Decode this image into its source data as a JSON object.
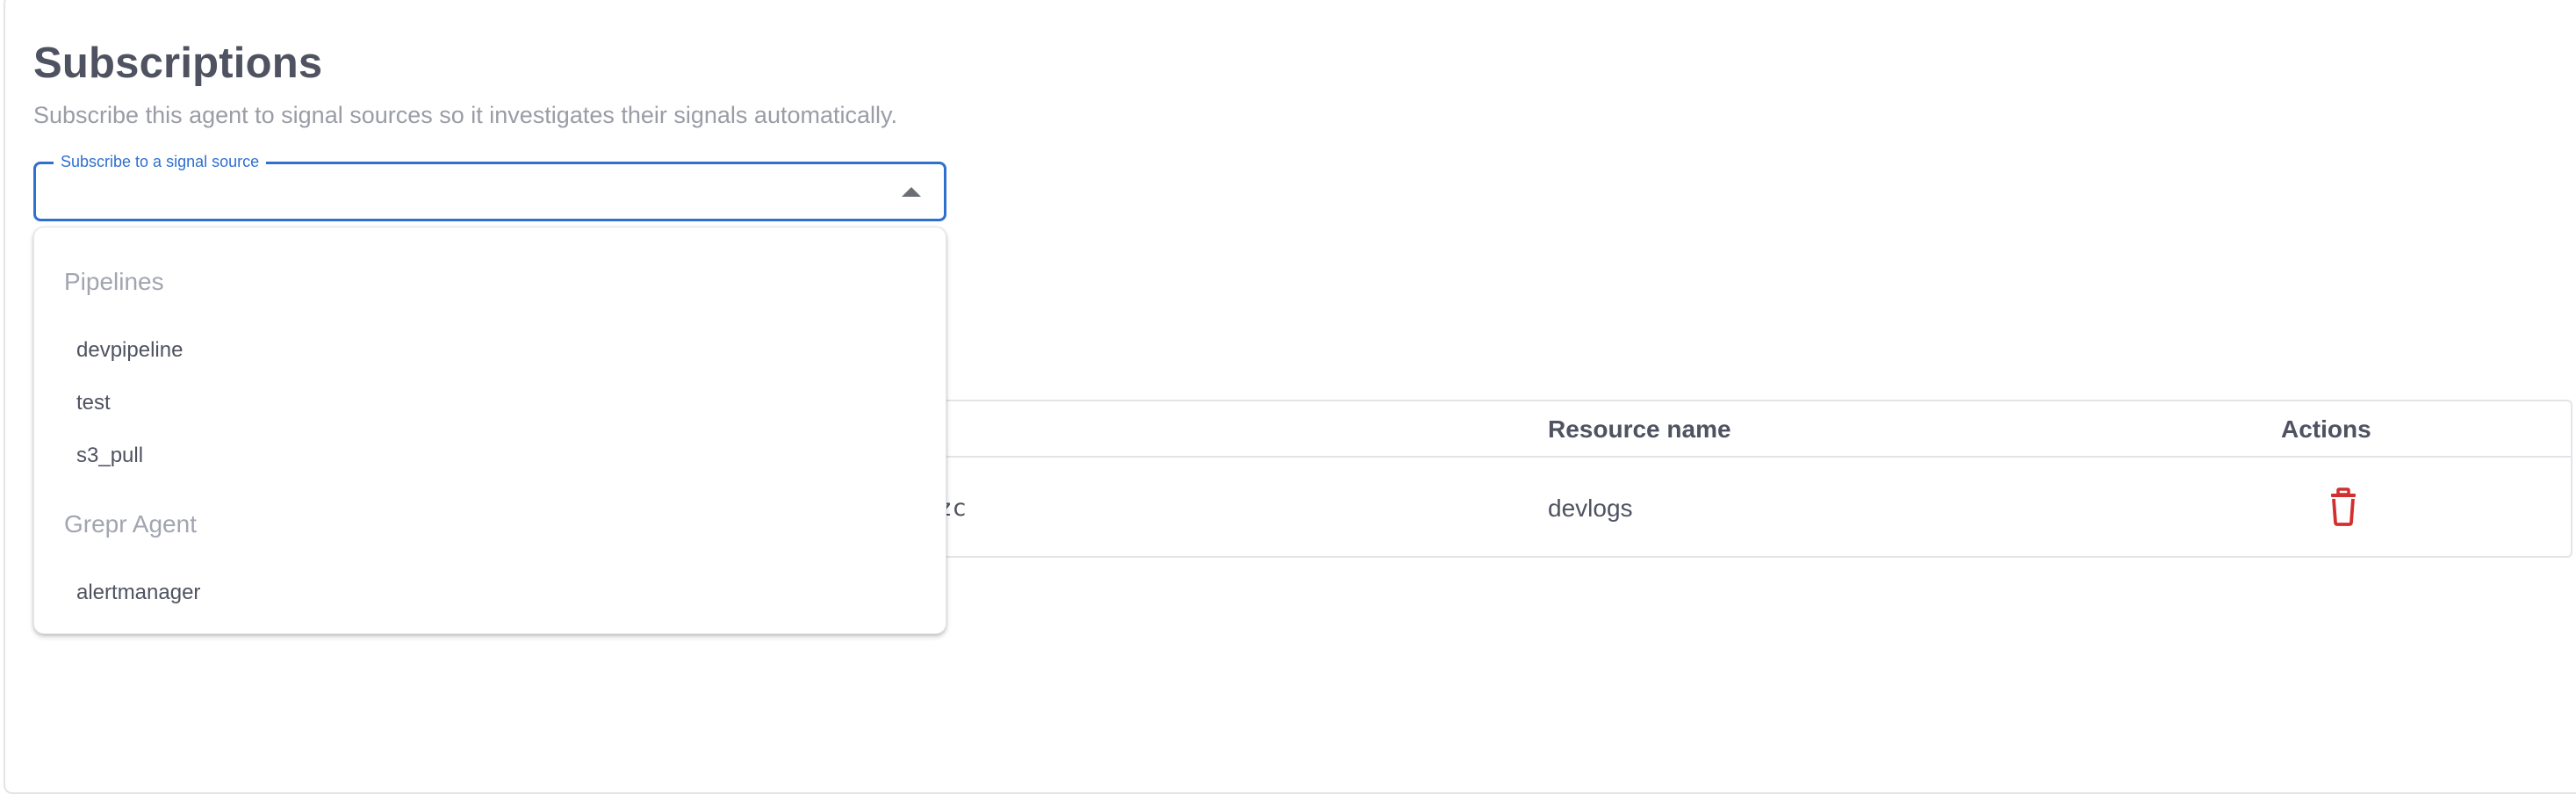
{
  "page": {
    "title": "Subscriptions",
    "subtitle": "Subscribe this agent to signal sources so it investigates their signals automatically."
  },
  "select": {
    "label": "Subscribe to a signal source",
    "value": ""
  },
  "dropdown": {
    "groups": [
      {
        "label": "Pipelines",
        "options": [
          "devpipeline",
          "test",
          "s3_pull"
        ]
      },
      {
        "label": "Grepr Agent",
        "options": [
          "alertmanager"
        ]
      }
    ]
  },
  "table": {
    "columns": {
      "id_fragment": "",
      "resource_name": "Resource name",
      "actions": "Actions"
    },
    "rows": [
      {
        "id_fragment": "ezc",
        "resource_name": "devlogs"
      }
    ]
  },
  "colors": {
    "accent": "#2f6fcf",
    "delete": "#d32f2f",
    "text": "#4f5260",
    "muted": "#9a9ca6"
  },
  "icons": {
    "select_arrow": "caret-up-icon",
    "delete": "trash-icon"
  }
}
